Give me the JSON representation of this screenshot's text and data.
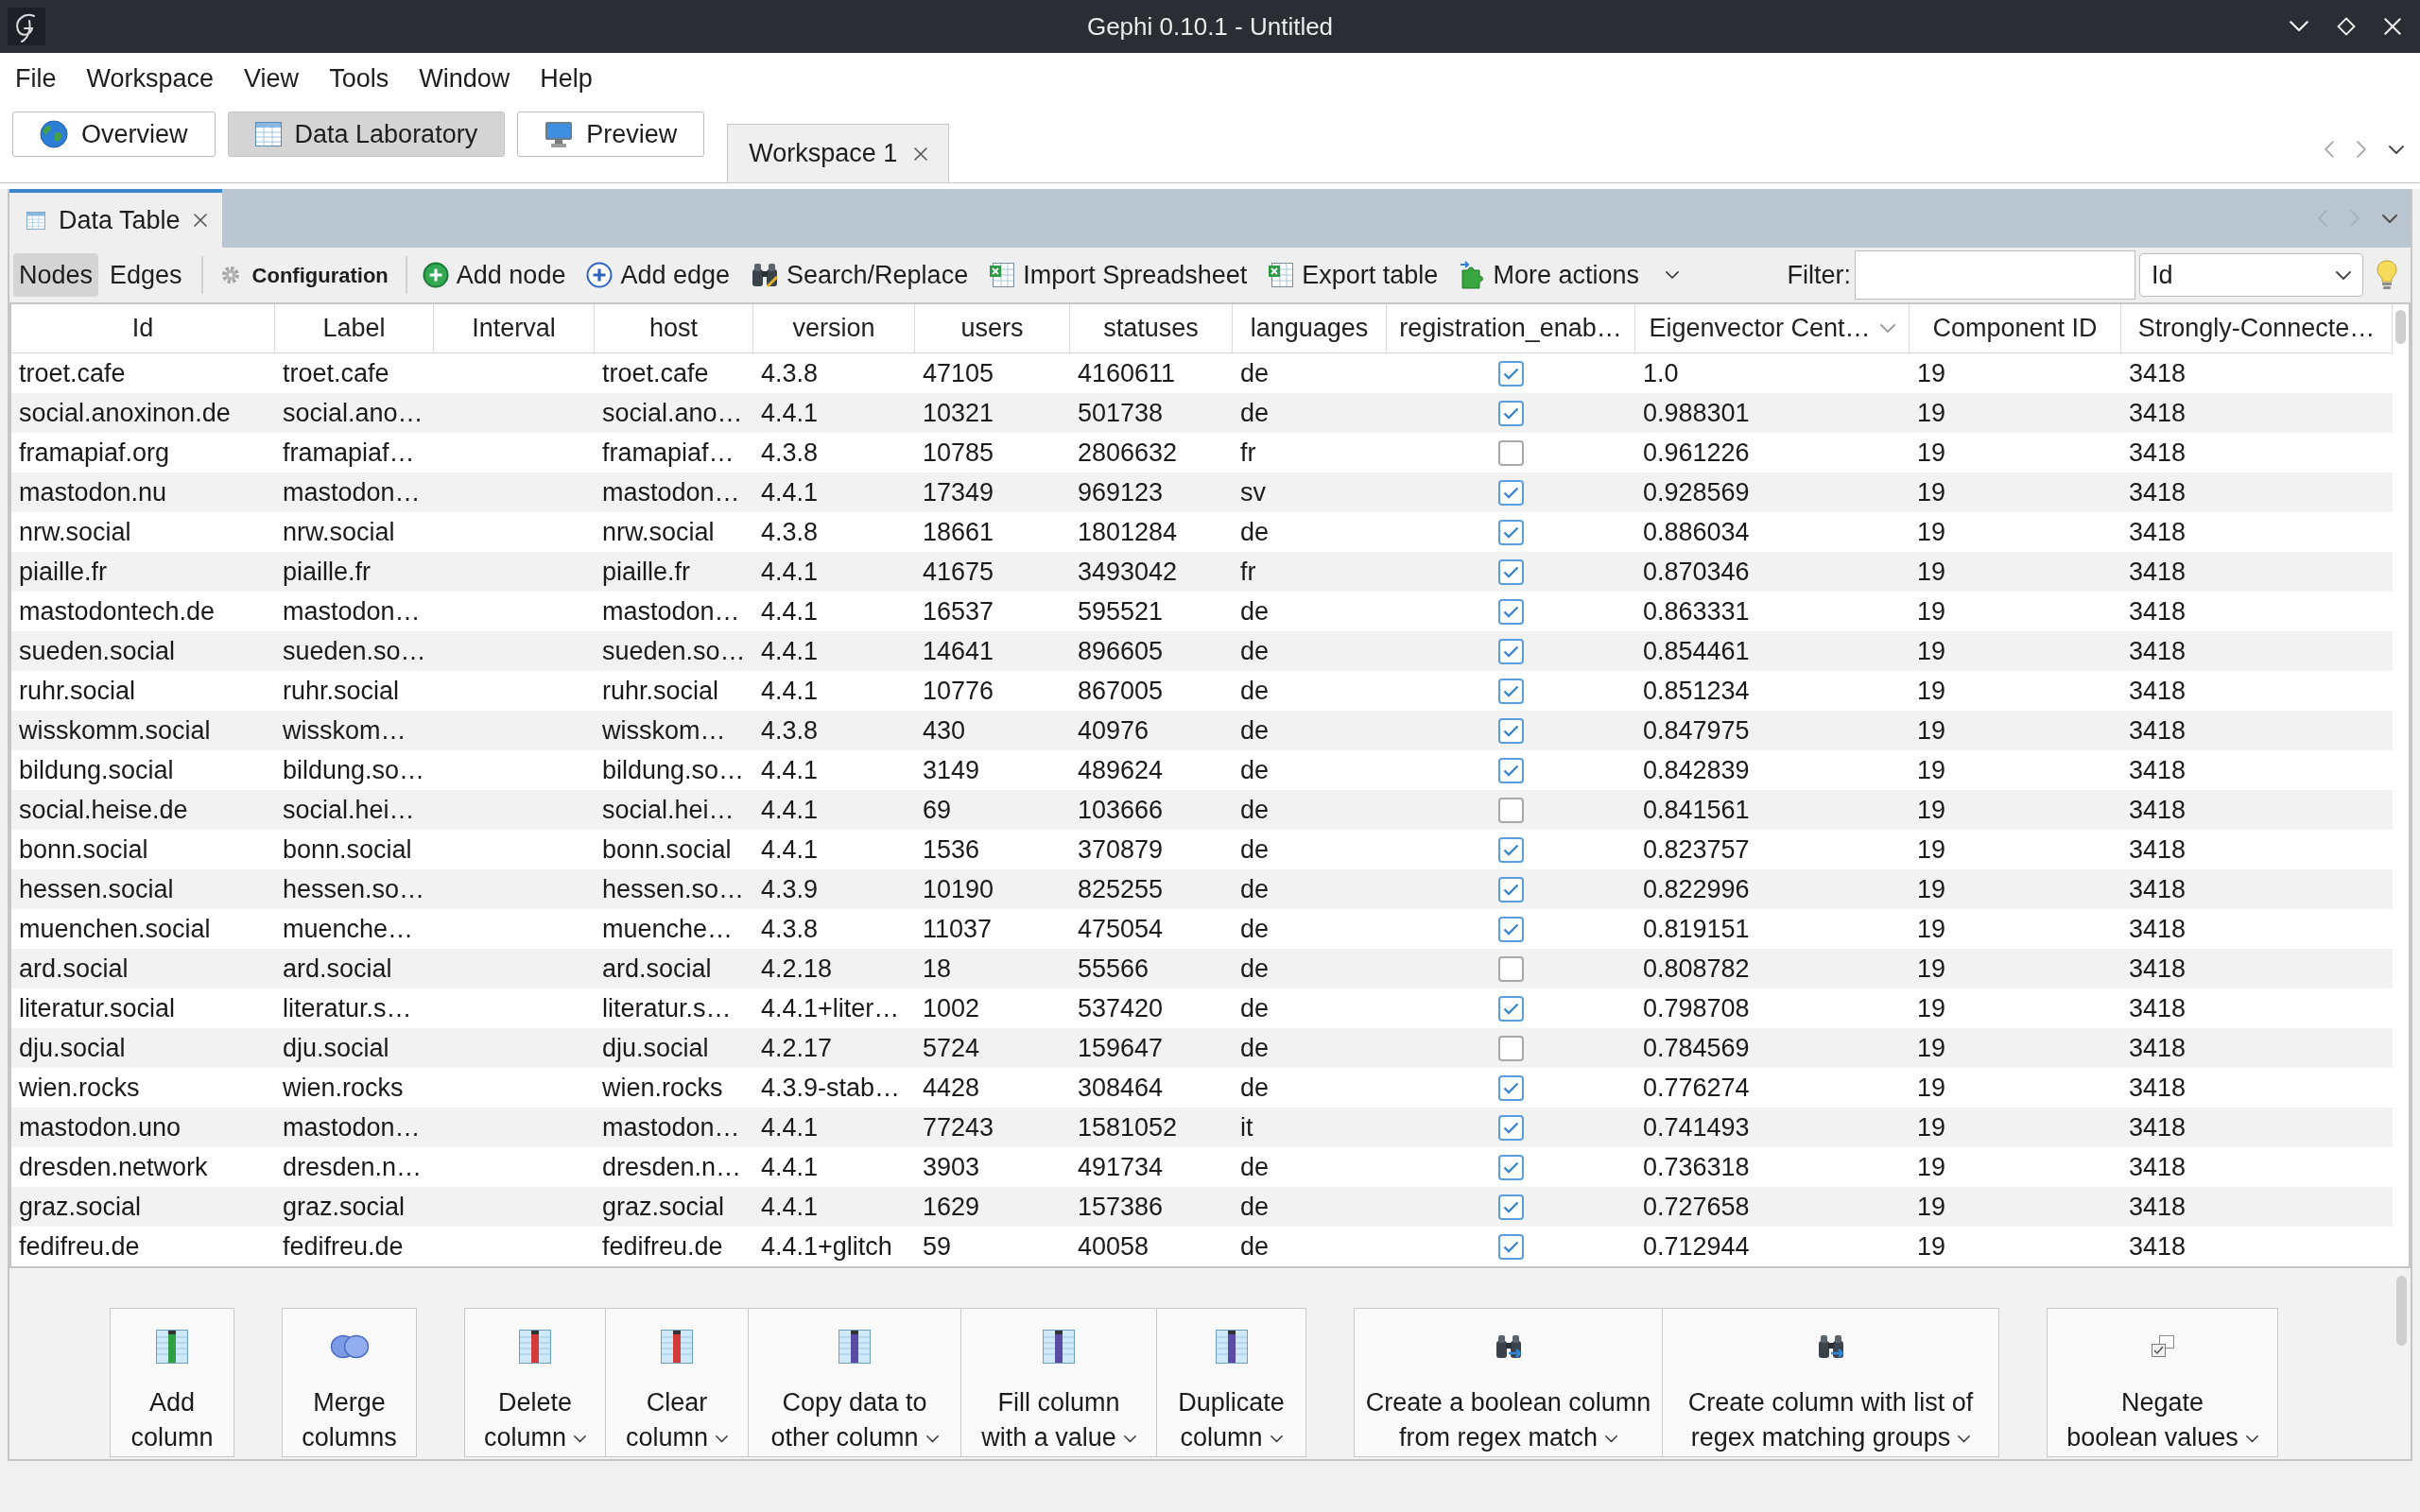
{
  "window": {
    "title": "Gephi 0.10.1 - Untitled"
  },
  "menu": [
    "File",
    "Workspace",
    "View",
    "Tools",
    "Window",
    "Help"
  ],
  "perspectives": [
    {
      "label": "Overview",
      "kind": "overview",
      "selected": false
    },
    {
      "label": "Data Laboratory",
      "kind": "laboratory",
      "selected": true
    },
    {
      "label": "Preview",
      "kind": "preview",
      "selected": false
    }
  ],
  "workspace_tabs": [
    {
      "label": "Workspace 1",
      "selected": true
    }
  ],
  "panel": {
    "tabs": [
      {
        "label": "Data Table",
        "selected": true
      }
    ]
  },
  "toolbar": {
    "views": [
      {
        "label": "Nodes",
        "selected": true
      },
      {
        "label": "Edges",
        "selected": false
      }
    ],
    "configuration": "Configuration",
    "actions": [
      {
        "label": "Add node",
        "kind": "node",
        "dropdown": false
      },
      {
        "label": "Add edge",
        "kind": "edge",
        "dropdown": false
      },
      {
        "label": "Search/Replace",
        "kind": "search",
        "dropdown": false
      },
      {
        "label": "Import Spreadsheet",
        "kind": "import",
        "dropdown": false
      },
      {
        "label": "Export table",
        "kind": "export",
        "dropdown": false
      },
      {
        "label": "More actions",
        "kind": "more",
        "dropdown": true
      }
    ],
    "filter": {
      "label": "Filter:",
      "column": "Id"
    }
  },
  "table": {
    "columns": [
      {
        "label": "Id",
        "kind": "text",
        "sorted": false
      },
      {
        "label": "Label",
        "kind": "text",
        "sorted": false
      },
      {
        "label": "Interval",
        "kind": "empty",
        "sorted": false
      },
      {
        "label": "host",
        "kind": "text",
        "sorted": false
      },
      {
        "label": "version",
        "kind": "text",
        "sorted": false
      },
      {
        "label": "users",
        "kind": "text",
        "sorted": false
      },
      {
        "label": "statuses",
        "kind": "text",
        "sorted": false
      },
      {
        "label": "languages",
        "kind": "text",
        "sorted": false
      },
      {
        "label": "registration_enab…",
        "kind": "check",
        "sorted": false
      },
      {
        "label": "Eigenvector Cent…",
        "kind": "text",
        "sorted": true
      },
      {
        "label": "Component ID",
        "kind": "text",
        "sorted": false
      },
      {
        "label": "Strongly-Connecte…",
        "kind": "text",
        "sorted": false
      }
    ],
    "rows": [
      {
        "values": [
          "troet.cafe",
          "troet.cafe",
          "troet.cafe",
          "4.3.8",
          "47105",
          "4160611",
          "de",
          "1.0",
          "19",
          "3418"
        ],
        "checked": true
      },
      {
        "values": [
          "social.anoxinon.de",
          "social.ano…",
          "social.ano…",
          "4.4.1",
          "10321",
          "501738",
          "de",
          "0.988301",
          "19",
          "3418"
        ],
        "checked": true
      },
      {
        "values": [
          "framapiaf.org",
          "framapiaf…",
          "framapiaf…",
          "4.3.8",
          "10785",
          "2806632",
          "fr",
          "0.961226",
          "19",
          "3418"
        ],
        "checked": false
      },
      {
        "values": [
          "mastodon.nu",
          "mastodon…",
          "mastodon…",
          "4.4.1",
          "17349",
          "969123",
          "sv",
          "0.928569",
          "19",
          "3418"
        ],
        "checked": true
      },
      {
        "values": [
          "nrw.social",
          "nrw.social",
          "nrw.social",
          "4.3.8",
          "18661",
          "1801284",
          "de",
          "0.886034",
          "19",
          "3418"
        ],
        "checked": true
      },
      {
        "values": [
          "piaille.fr",
          "piaille.fr",
          "piaille.fr",
          "4.4.1",
          "41675",
          "3493042",
          "fr",
          "0.870346",
          "19",
          "3418"
        ],
        "checked": true
      },
      {
        "values": [
          "mastodontech.de",
          "mastodon…",
          "mastodon…",
          "4.4.1",
          "16537",
          "595521",
          "de",
          "0.863331",
          "19",
          "3418"
        ],
        "checked": true
      },
      {
        "values": [
          "sueden.social",
          "sueden.so…",
          "sueden.so…",
          "4.4.1",
          "14641",
          "896605",
          "de",
          "0.854461",
          "19",
          "3418"
        ],
        "checked": true
      },
      {
        "values": [
          "ruhr.social",
          "ruhr.social",
          "ruhr.social",
          "4.4.1",
          "10776",
          "867005",
          "de",
          "0.851234",
          "19",
          "3418"
        ],
        "checked": true
      },
      {
        "values": [
          "wisskomm.social",
          "wisskom…",
          "wisskom…",
          "4.3.8",
          "430",
          "40976",
          "de",
          "0.847975",
          "19",
          "3418"
        ],
        "checked": true
      },
      {
        "values": [
          "bildung.social",
          "bildung.so…",
          "bildung.so…",
          "4.4.1",
          "3149",
          "489624",
          "de",
          "0.842839",
          "19",
          "3418"
        ],
        "checked": true
      },
      {
        "values": [
          "social.heise.de",
          "social.hei…",
          "social.hei…",
          "4.4.1",
          "69",
          "103666",
          "de",
          "0.841561",
          "19",
          "3418"
        ],
        "checked": false
      },
      {
        "values": [
          "bonn.social",
          "bonn.social",
          "bonn.social",
          "4.4.1",
          "1536",
          "370879",
          "de",
          "0.823757",
          "19",
          "3418"
        ],
        "checked": true
      },
      {
        "values": [
          "hessen.social",
          "hessen.so…",
          "hessen.so…",
          "4.3.9",
          "10190",
          "825255",
          "de",
          "0.822996",
          "19",
          "3418"
        ],
        "checked": true
      },
      {
        "values": [
          "muenchen.social",
          "muenche…",
          "muenche…",
          "4.3.8",
          "11037",
          "475054",
          "de",
          "0.819151",
          "19",
          "3418"
        ],
        "checked": true
      },
      {
        "values": [
          "ard.social",
          "ard.social",
          "ard.social",
          "4.2.18",
          "18",
          "55566",
          "de",
          "0.808782",
          "19",
          "3418"
        ],
        "checked": false
      },
      {
        "values": [
          "literatur.social",
          "literatur.s…",
          "literatur.s…",
          "4.4.1+liter…",
          "1002",
          "537420",
          "de",
          "0.798708",
          "19",
          "3418"
        ],
        "checked": true
      },
      {
        "values": [
          "dju.social",
          "dju.social",
          "dju.social",
          "4.2.17",
          "5724",
          "159647",
          "de",
          "0.784569",
          "19",
          "3418"
        ],
        "checked": false
      },
      {
        "values": [
          "wien.rocks",
          "wien.rocks",
          "wien.rocks",
          "4.3.9-stab…",
          "4428",
          "308464",
          "de",
          "0.776274",
          "19",
          "3418"
        ],
        "checked": true
      },
      {
        "values": [
          "mastodon.uno",
          "mastodon…",
          "mastodon…",
          "4.4.1",
          "77243",
          "1581052",
          "it",
          "0.741493",
          "19",
          "3418"
        ],
        "checked": true
      },
      {
        "values": [
          "dresden.network",
          "dresden.n…",
          "dresden.n…",
          "4.4.1",
          "3903",
          "491734",
          "de",
          "0.736318",
          "19",
          "3418"
        ],
        "checked": true
      },
      {
        "values": [
          "graz.social",
          "graz.social",
          "graz.social",
          "4.4.1",
          "1629",
          "157386",
          "de",
          "0.727658",
          "19",
          "3418"
        ],
        "checked": true
      },
      {
        "values": [
          "fedifreu.de",
          "fedifreu.de",
          "fedifreu.de",
          "4.4.1+glitch",
          "59",
          "40058",
          "de",
          "0.712944",
          "19",
          "3418"
        ],
        "checked": true
      }
    ]
  },
  "column_actions": {
    "groups": [
      {
        "actions": [
          {
            "label": "Add\ncolumn",
            "kind": "add",
            "dropdown": false
          }
        ]
      },
      {
        "actions": [
          {
            "label": "Merge\ncolumns",
            "kind": "merge",
            "dropdown": false
          }
        ]
      },
      {
        "actions": [
          {
            "label": "Delete\ncolumn",
            "kind": "remove",
            "dropdown": true
          },
          {
            "label": "Clear\ncolumn",
            "kind": "remove",
            "dropdown": true
          },
          {
            "label": "Copy data to\nother column",
            "kind": "edit",
            "dropdown": true
          },
          {
            "label": "Fill column\nwith a value",
            "kind": "edit",
            "dropdown": true
          },
          {
            "label": "Duplicate\ncolumn",
            "kind": "edit",
            "dropdown": true
          }
        ]
      },
      {
        "actions": [
          {
            "label": "Create a boolean column\nfrom regex match",
            "kind": "search",
            "dropdown": true
          },
          {
            "label": "Create column with list of\nregex matching groups",
            "kind": "search",
            "dropdown": true
          }
        ]
      },
      {
        "actions": [
          {
            "label": "Negate\nboolean values",
            "kind": "negate",
            "dropdown": true
          }
        ]
      }
    ]
  }
}
